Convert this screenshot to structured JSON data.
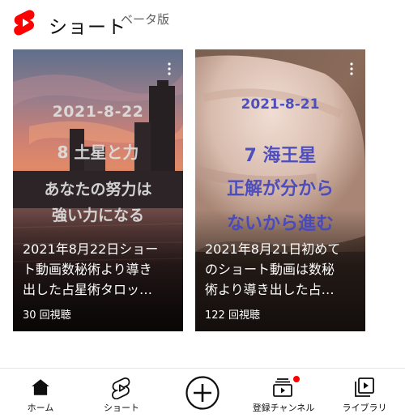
{
  "header": {
    "title": "ショート",
    "beta_label": "ベータ版",
    "logo_icon": "youtube-shorts-logo",
    "brand_color": "#ff0000"
  },
  "cards": [
    {
      "overlay_date": "2021-8-22",
      "overlay_line1": "8 土星と力",
      "overlay_line2": "あなたの努力は",
      "overlay_line3": "強い力になる",
      "title_line1": "2021年8月22日ショー",
      "title_line2": "ト動画数秘術より導き",
      "title_line3": "出した占星術タロッ…",
      "views": "30 回視聴",
      "menu_icon": "more-vert-icon"
    },
    {
      "overlay_date": "2021-8-21",
      "overlay_line1": "7 海王星",
      "overlay_line2": "正解が分から",
      "overlay_line3": "ないから進む",
      "title_line1": "2021年8月21日初めて",
      "title_line2": "のショート動画は数秘",
      "title_line3": "術より導き出した占…",
      "views": "122 回視聴",
      "menu_icon": "more-vert-icon"
    }
  ],
  "nav": {
    "home": "ホーム",
    "shorts": "ショート",
    "create_icon": "add-circle-icon",
    "subscriptions": "登録チャンネル",
    "library": "ライブラリ"
  }
}
